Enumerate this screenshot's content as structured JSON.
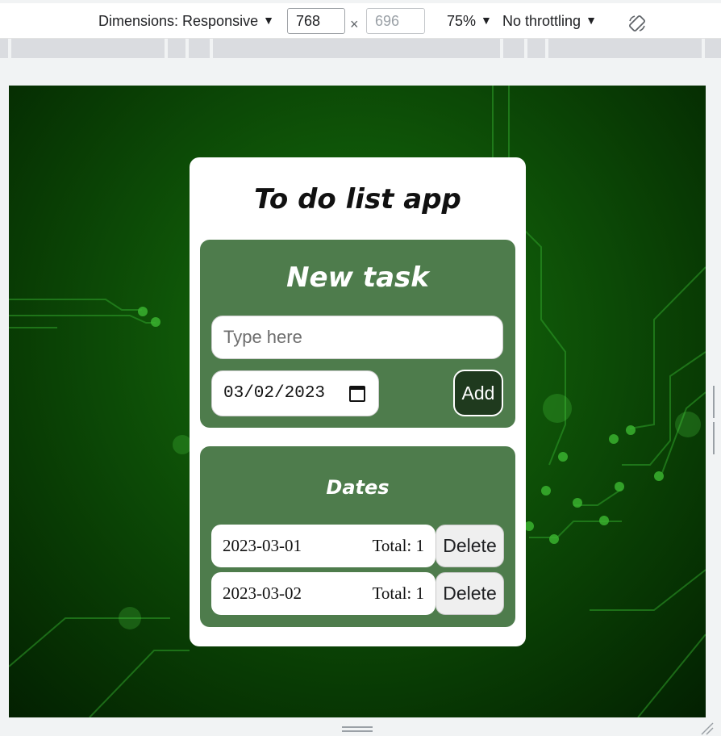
{
  "devtools": {
    "dimensions_label": "Dimensions: Responsive",
    "width": "768",
    "height": "696",
    "times": "×",
    "zoom": "75%",
    "throttling": "No throttling",
    "icons": [
      "caret-down-icon",
      "rotate-icon"
    ]
  },
  "app": {
    "title": "To do list app",
    "new_task": {
      "heading": "New task",
      "placeholder": "Type here",
      "date_value": "03/02/2023",
      "add_label": "Add"
    },
    "dates": {
      "heading": "Dates",
      "items": [
        {
          "date": "2023-03-01",
          "total": "Total: 1",
          "delete_label": "Delete"
        },
        {
          "date": "2023-03-02",
          "total": "Total: 1",
          "delete_label": "Delete"
        }
      ]
    }
  },
  "colors": {
    "panel": "#4e7c4c",
    "add_button": "#1f3a1e",
    "background": "#0f5608"
  }
}
